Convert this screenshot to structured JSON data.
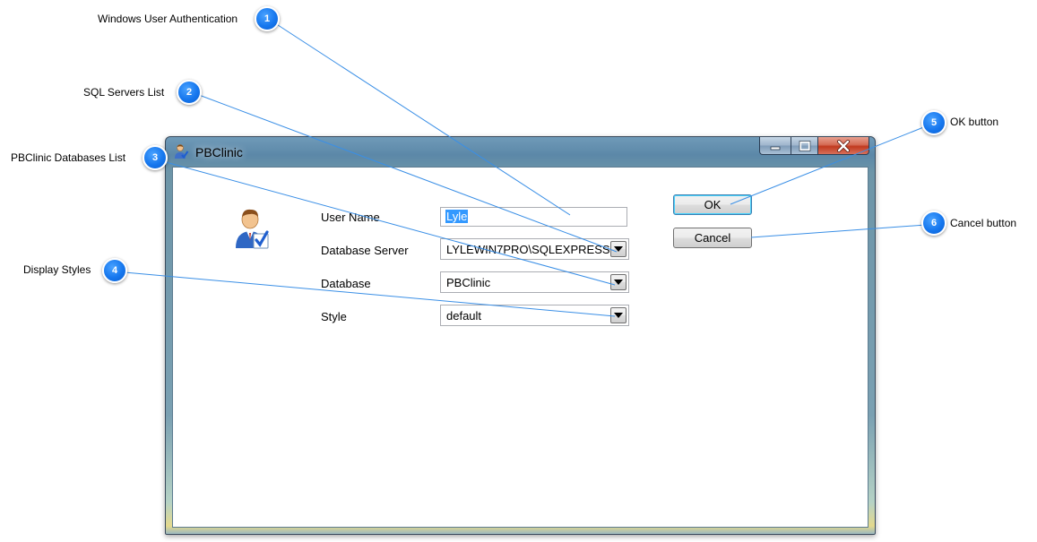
{
  "annotations": [
    {
      "number": "1",
      "label": "Windows User Authentication"
    },
    {
      "number": "2",
      "label": "SQL Servers List"
    },
    {
      "number": "3",
      "label": "PBClinic Databases List"
    },
    {
      "number": "4",
      "label": "Display Styles"
    },
    {
      "number": "5",
      "label": "OK button"
    },
    {
      "number": "6",
      "label": "Cancel button"
    }
  ],
  "window": {
    "title": "PBClinic",
    "icon": "user-check-icon",
    "caption_buttons": [
      "minimize-icon",
      "maximize-icon",
      "close-icon"
    ]
  },
  "form": {
    "user_name": {
      "label": "User Name",
      "value": "Lyle"
    },
    "database_server": {
      "label": "Database Server",
      "value": "LYLEWIN7PRO\\SQLEXPRESS"
    },
    "database": {
      "label": "Database",
      "value": "PBClinic"
    },
    "style": {
      "label": "Style",
      "value": "default"
    }
  },
  "buttons": {
    "ok": "OK",
    "cancel": "Cancel"
  },
  "colors": {
    "badge": "#1677ee",
    "leader_line": "#3a8fe6",
    "selection": "#3399ff"
  }
}
